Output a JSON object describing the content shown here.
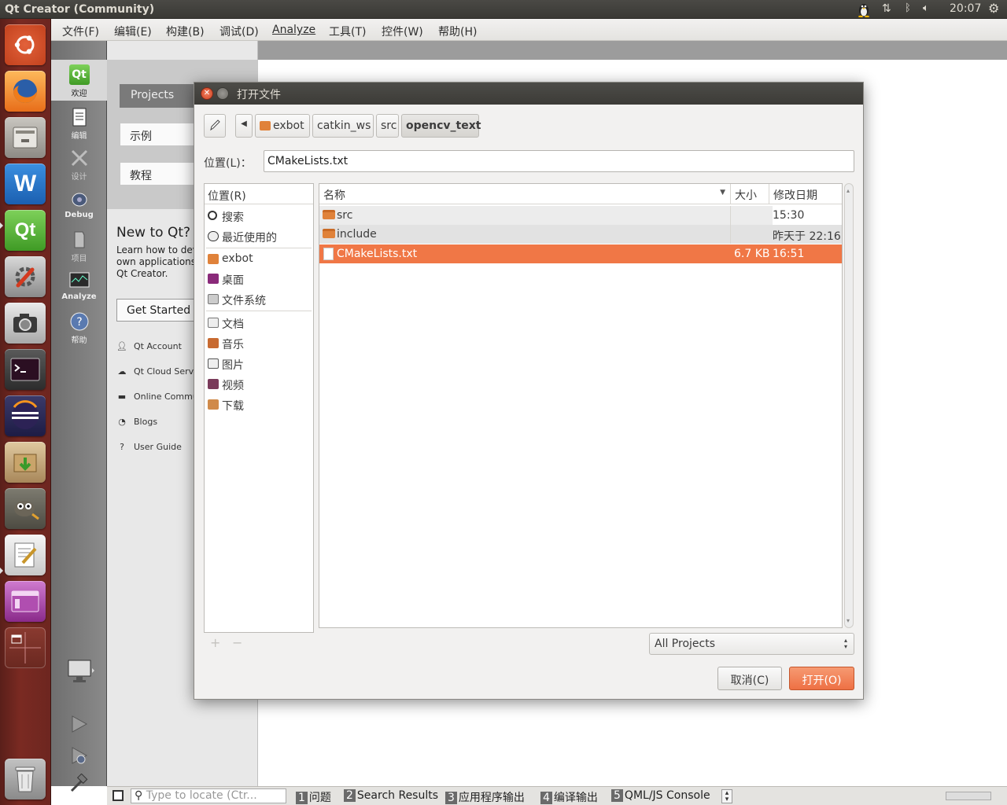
{
  "topbar": {
    "app_title": "Qt Creator (Community)",
    "clock": "20:07",
    "indicators": [
      "linux-tux-icon",
      "network-updown-icon",
      "bluetooth-icon",
      "volume-icon",
      "settings-gear-icon"
    ]
  },
  "menubar": {
    "items": [
      "文件(F)",
      "编辑(E)",
      "构建(B)",
      "调试(D)",
      "Analyze",
      "工具(T)",
      "控件(W)",
      "帮助(H)"
    ]
  },
  "launcher": {
    "items": [
      "ubuntu-dash-icon",
      "firefox-icon",
      "file-manager-icon",
      "wps-writer-icon",
      "qt-creator-icon",
      "system-settings-icon",
      "camera-icon",
      "terminal-icon",
      "eclipse-icon",
      "archive-manager-icon",
      "gimp-icon",
      "text-editor-icon",
      "purple-app-icon",
      "workspace-switcher-icon",
      "trash-icon"
    ]
  },
  "modes": {
    "items": [
      "欢迎",
      "编辑",
      "设计",
      "Debug",
      "项目",
      "Analyze",
      "帮助"
    ]
  },
  "welcome": {
    "projects": "Projects",
    "examples": "示例",
    "tutorials": "教程",
    "new_title": "New to Qt?",
    "new_text": [
      "Learn how to deve",
      "own applications a",
      "Qt Creator."
    ],
    "get_started": "Get Started N",
    "links": [
      "Qt Account",
      "Qt Cloud Servic",
      "Online Commu",
      "Blogs",
      "User Guide"
    ]
  },
  "dialog": {
    "title": "打开文件",
    "breadcrumbs": [
      "exbot",
      "catkin_ws",
      "src",
      "opencv_text"
    ],
    "location_label": "位置(L)：",
    "location_value": "CMakeLists.txt",
    "places_header": "位置(R)",
    "places": [
      "搜索",
      "最近使用的",
      "exbot",
      "桌面",
      "文件系统",
      "文档",
      "音乐",
      "图片",
      "视频",
      "下载"
    ],
    "columns": {
      "name": "名称",
      "size": "大小",
      "modified": "修改日期"
    },
    "files": [
      {
        "name": "src",
        "size": "",
        "modified": "15:30",
        "kind": "folder"
      },
      {
        "name": "include",
        "size": "",
        "modified": "昨天于 22:16",
        "kind": "folder"
      },
      {
        "name": "CMakeLists.txt",
        "size": "6.7 KB",
        "modified": "16:51",
        "kind": "file"
      }
    ],
    "filter": "All Projects",
    "cancel": "取消(C)",
    "open": "打开(O)",
    "add": "+",
    "remove": "−"
  },
  "statusbar": {
    "locate_placeholder": "Type to locate (Ctr...",
    "tabs": [
      {
        "num": "1",
        "label": "问题"
      },
      {
        "num": "2",
        "label": "Search Results"
      },
      {
        "num": "3",
        "label": "应用程序输出"
      },
      {
        "num": "4",
        "label": "编译输出"
      },
      {
        "num": "5",
        "label": "QML/JS Console"
      }
    ]
  },
  "colors": {
    "accent": "#f07746",
    "launcher": "#6d2620",
    "titlebar": "#3c3b37"
  }
}
